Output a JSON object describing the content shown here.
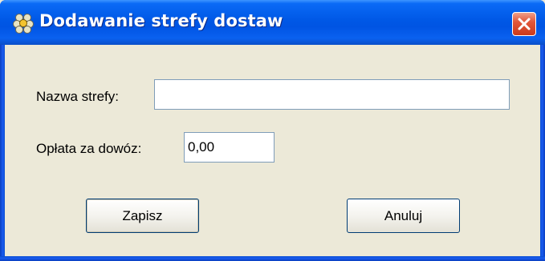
{
  "window": {
    "title": "Dodawanie strefy dostaw",
    "app_icon": "app-logo-icon",
    "close_icon": "close-icon"
  },
  "form": {
    "zone_name": {
      "label": "Nazwa strefy:",
      "value": ""
    },
    "delivery_fee": {
      "label": "Opłata za dowóz:",
      "value": "0,00"
    }
  },
  "buttons": {
    "save_label": "Zapisz",
    "cancel_label": "Anuluj"
  },
  "colors": {
    "titlebar": "#0054e3",
    "dialog_background": "#ece9d8",
    "close_button": "#e2573a",
    "input_border": "#7f9db9"
  }
}
